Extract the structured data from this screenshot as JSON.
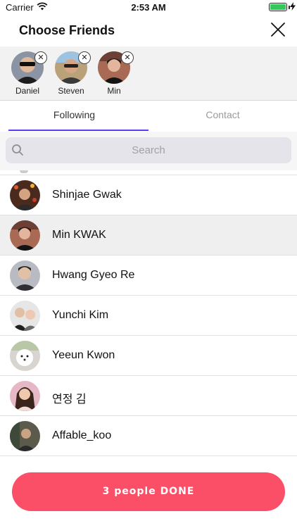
{
  "status_bar": {
    "carrier": "Carrier",
    "time": "2:53 AM",
    "battery_level": 1.0,
    "battery_color": "#34c759"
  },
  "header": {
    "title": "Choose Friends",
    "close_icon": "close-icon"
  },
  "selected": [
    {
      "name": "Daniel",
      "remove_icon": "remove-icon",
      "remove_glyph": "✕"
    },
    {
      "name": "Steven",
      "remove_icon": "remove-icon",
      "remove_glyph": "✕"
    },
    {
      "name": "Min",
      "remove_icon": "remove-icon",
      "remove_glyph": "✕"
    }
  ],
  "tabs": [
    {
      "label": "Following",
      "active": true
    },
    {
      "label": "Contact",
      "active": false
    }
  ],
  "search": {
    "placeholder": "Search",
    "value": ""
  },
  "friends": [
    {
      "name": "Shinjae Gwak",
      "selected": false
    },
    {
      "name": "Min KWAK",
      "selected": true
    },
    {
      "name": "Hwang Gyeo Re",
      "selected": false
    },
    {
      "name": "Yunchi Kim",
      "selected": false
    },
    {
      "name": "Yeeun Kwon",
      "selected": false
    },
    {
      "name": "연정 김",
      "selected": false
    },
    {
      "name": "Affable_koo",
      "selected": false
    }
  ],
  "done_button": {
    "label": "3 people DONE"
  },
  "colors": {
    "accent": "#fb4f67",
    "tab_indicator": "#5b3df5",
    "highlight_row": "#efefef"
  }
}
